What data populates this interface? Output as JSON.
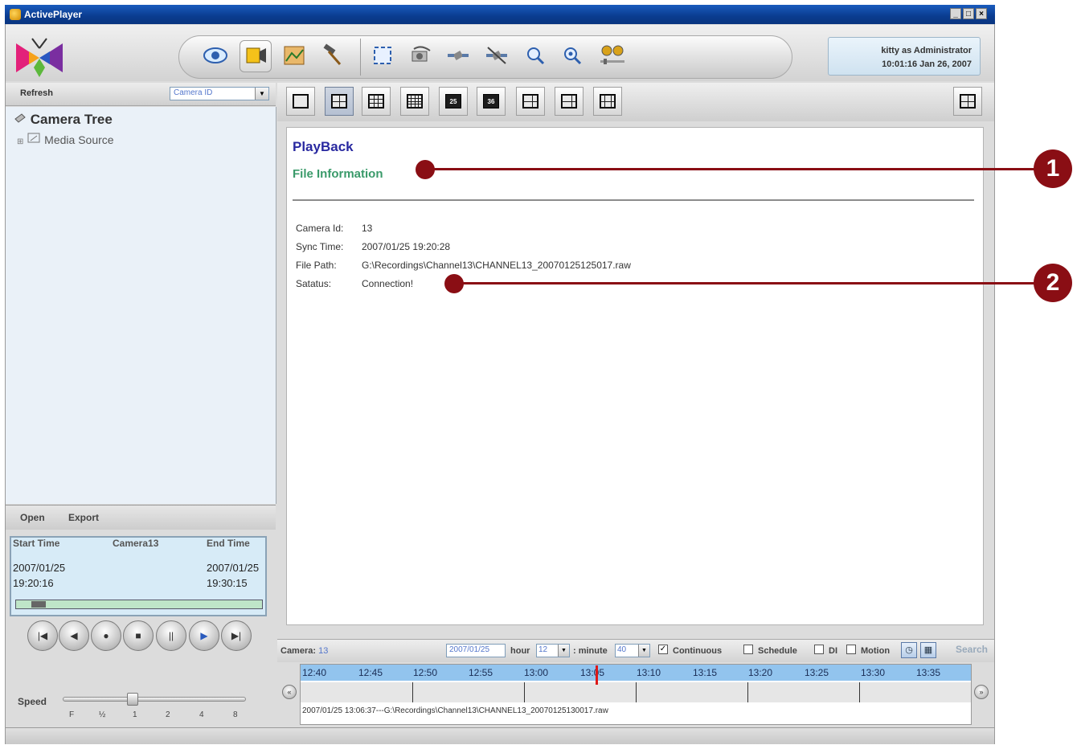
{
  "window": {
    "title": "ActivePlayer",
    "controls": [
      "_",
      "□",
      "×"
    ]
  },
  "toolbar": {
    "icons": [
      "eye-icon",
      "video-tool-icon",
      "map-icon",
      "hammer-icon",
      "fullscreen-icon",
      "camera-rotate-icon",
      "satellite-icon",
      "satellite-off-icon",
      "zoom-in-icon",
      "zoom-out-icon",
      "binoculars-icon"
    ]
  },
  "user": {
    "line1": "kitty as Administrator",
    "line2": "10:01:16 Jan 26, 2007"
  },
  "left": {
    "refresh": "Refresh",
    "camera_select": "Camera ID",
    "tree_root": "Camera Tree",
    "tree_child": "Media Source",
    "open": "Open",
    "export": "Export"
  },
  "clipinfo": {
    "start_label": "Start Time",
    "camera_label": "Camera13",
    "end_label": "End Time",
    "start_date": "2007/01/25",
    "start_time": "19:20:16",
    "end_date": "2007/01/25",
    "end_time": "19:30:15",
    "progress": 0.05
  },
  "playback_controls": [
    "|◀",
    "◀",
    "●",
    "■",
    "||",
    "▶",
    "▶|"
  ],
  "speed": {
    "label": "Speed",
    "ticks": [
      "F",
      "½",
      "1",
      "2",
      "4",
      "8"
    ],
    "current": "1"
  },
  "layouts": [
    "1",
    "4",
    "9",
    "16",
    "25",
    "36",
    "6",
    "8",
    "13"
  ],
  "playback": {
    "title": "PlayBack",
    "subtitle": "File Information",
    "rows": [
      {
        "key": "Camera Id:",
        "value": "13"
      },
      {
        "key": "Sync Time:",
        "value": "2007/01/25 19:20:28"
      },
      {
        "key": "File Path:",
        "value": "G:\\Recordings\\Channel13\\CHANNEL13_20070125125017.raw"
      },
      {
        "key": "Satatus:",
        "value": "Connection!"
      }
    ]
  },
  "callouts": [
    "1",
    "2"
  ],
  "search": {
    "camera_label": "Camera:",
    "camera_value": "13",
    "date": "2007/01/25",
    "hour_label": "hour",
    "hour_value": "12",
    "minute_label": ": minute",
    "minute_value": "40",
    "continuous": "Continuous",
    "schedule": "Schedule",
    "di": "DI",
    "motion": "Motion",
    "button": "Search",
    "continuous_checked": true
  },
  "timeline": {
    "hours": [
      "12:40",
      "12:45",
      "12:50",
      "12:55",
      "13:00",
      "13:05",
      "13:10",
      "13:15",
      "13:20",
      "13:25",
      "13:30",
      "13:35"
    ],
    "file": "2007/01/25 13:06:37---G:\\Recordings\\Channel13\\CHANNEL13_20070125130017.raw"
  },
  "colors": {
    "title_blue": "#2929a0",
    "subtitle_green": "#3a9a6a",
    "callout_red": "#8a0e14",
    "timeline_blue": "#92c4ee"
  }
}
